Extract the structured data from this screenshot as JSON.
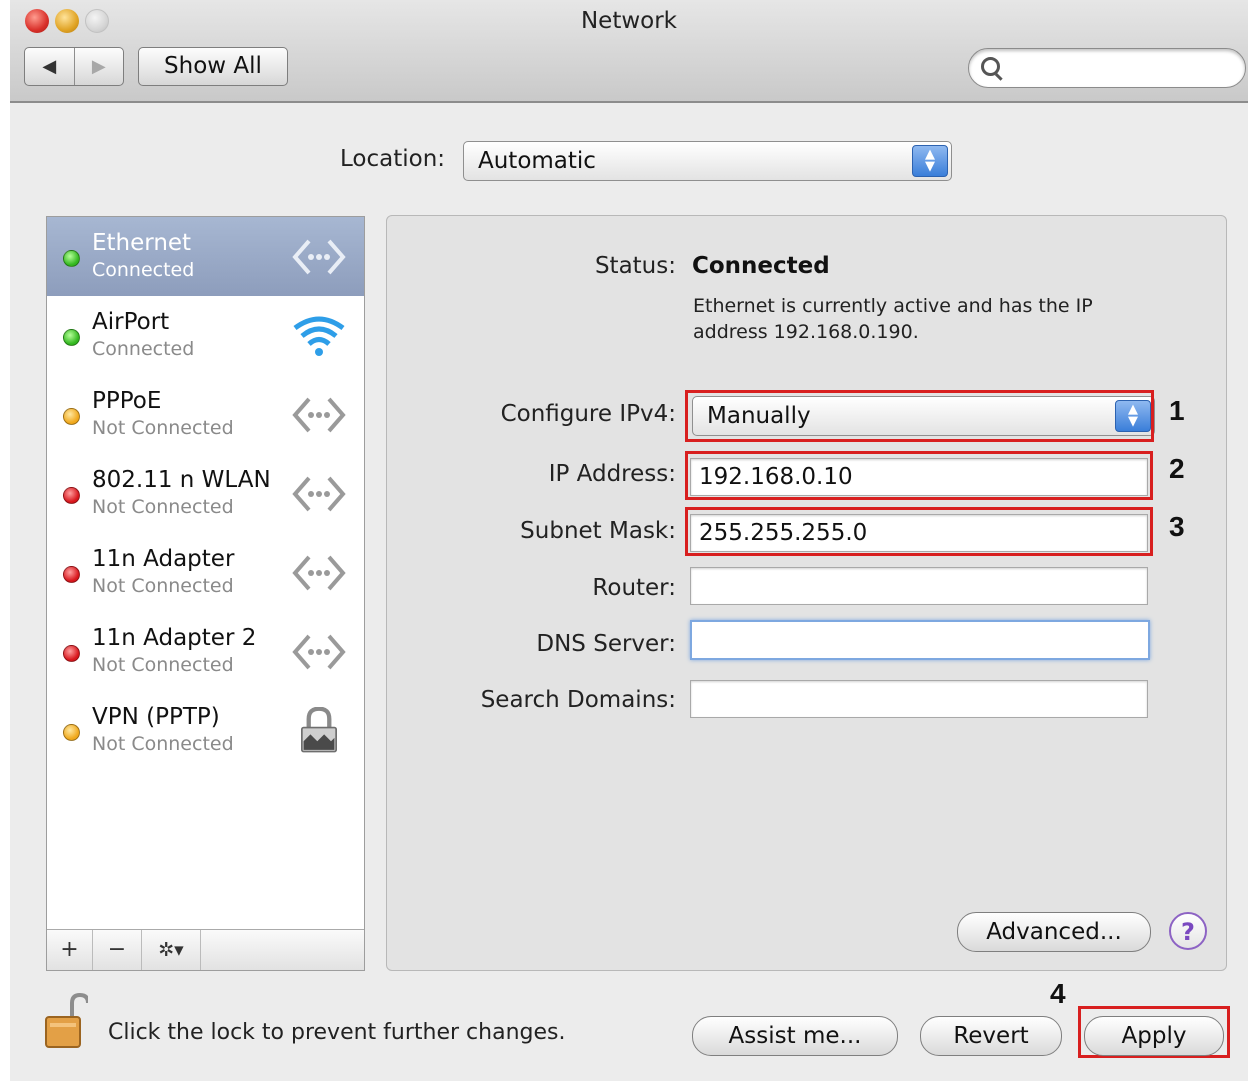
{
  "window": {
    "title": "Network"
  },
  "toolbar": {
    "back": "◀",
    "forward": "▶",
    "show_all": "Show All",
    "search_placeholder": ""
  },
  "location": {
    "label": "Location:",
    "value": "Automatic"
  },
  "services": [
    {
      "name": "Ethernet",
      "status": "Connected",
      "color": "green",
      "icon": "ethernet-icon",
      "selected": true
    },
    {
      "name": "AirPort",
      "status": "Connected",
      "color": "green",
      "icon": "wifi-icon"
    },
    {
      "name": "PPPoE",
      "status": "Not Connected",
      "color": "yellow",
      "icon": "ethernet-icon"
    },
    {
      "name": "802.11 n WLAN",
      "status": "Not Connected",
      "color": "red",
      "icon": "ethernet-icon"
    },
    {
      "name": "11n Adapter",
      "status": "Not Connected",
      "color": "red",
      "icon": "ethernet-icon"
    },
    {
      "name": "11n Adapter 2",
      "status": "Not Connected",
      "color": "red",
      "icon": "ethernet-icon"
    },
    {
      "name": "VPN (PPTP)",
      "status": "Not Connected",
      "color": "yellow",
      "icon": "vpn-lock-icon"
    }
  ],
  "sidebar_footer": {
    "add": "+",
    "remove": "−",
    "action": "✲▾"
  },
  "detail": {
    "status_label": "Status:",
    "status_value": "Connected",
    "status_desc": "Ethernet is currently active and has the IP address 192.168.0.190.",
    "configure_label": "Configure IPv4:",
    "configure_value": "Manually",
    "ip_label": "IP Address:",
    "ip_value": "192.168.0.10",
    "subnet_label": "Subnet Mask:",
    "subnet_value": "255.255.255.0",
    "router_label": "Router:",
    "router_value": "",
    "dns_label": "DNS Server:",
    "dns_value": "",
    "search_label": "Search Domains:",
    "search_value": "",
    "advanced": "Advanced...",
    "help": "?"
  },
  "annotations": {
    "n1": "1",
    "n2": "2",
    "n3": "3",
    "n4": "4",
    "highlight_color": "#d81f1f"
  },
  "footer": {
    "lock_text": "Click the lock to prevent further changes.",
    "assist": "Assist me...",
    "revert": "Revert",
    "apply": "Apply"
  }
}
